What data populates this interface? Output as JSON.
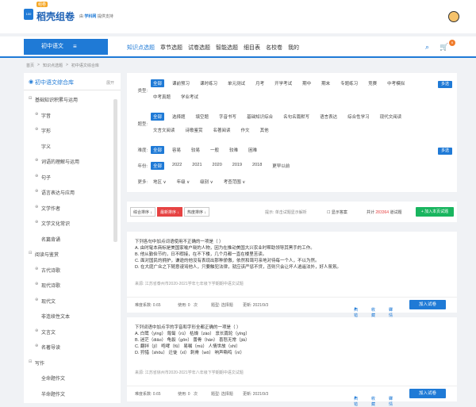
{
  "header": {
    "badge": "组卷",
    "brand": "稻壳组卷",
    "provider_prefix": "由",
    "provider_name": "学科网",
    "provider_suffix": "提供支持"
  },
  "nav": {
    "subject": "初中语文",
    "items": [
      "知识点选题",
      "章节选题",
      "试卷选题",
      "智能选题",
      "细目表",
      "名校卷",
      "我的"
    ],
    "cart_count": "6"
  },
  "breadcrumb": [
    "首页",
    ">",
    "知识点选题",
    ">",
    "初中语文综合库"
  ],
  "sidebar": {
    "title": "初中语文综合库",
    "expand": "展开",
    "tree": [
      {
        "toggle": "⊟",
        "label": "基础知识积累与运用",
        "level": 0
      },
      {
        "toggle": "⊕",
        "label": "字音",
        "level": 1
      },
      {
        "toggle": "⊕",
        "label": "字形",
        "level": 1
      },
      {
        "toggle": "",
        "label": "字义",
        "level": 1
      },
      {
        "toggle": "⊕",
        "label": "词语的理解与运用",
        "level": 1
      },
      {
        "toggle": "⊕",
        "label": "句子",
        "level": 1
      },
      {
        "toggle": "⊕",
        "label": "语言表达与应用",
        "level": 1
      },
      {
        "toggle": "⊕",
        "label": "文学作者",
        "level": 1
      },
      {
        "toggle": "⊕",
        "label": "文学文化常识",
        "level": 1
      },
      {
        "toggle": "",
        "label": "名篇背诵",
        "level": 1
      },
      {
        "toggle": "⊟",
        "label": "阅读与鉴赏",
        "level": 0
      },
      {
        "toggle": "⊕",
        "label": "古代诗歌",
        "level": 1
      },
      {
        "toggle": "⊕",
        "label": "现代诗歌",
        "level": 1
      },
      {
        "toggle": "⊕",
        "label": "现代文",
        "level": 1
      },
      {
        "toggle": "",
        "label": "非连续性文本",
        "level": 1
      },
      {
        "toggle": "⊕",
        "label": "文言文",
        "level": 1
      },
      {
        "toggle": "⊕",
        "label": "名著导读",
        "level": 1
      },
      {
        "toggle": "⊟",
        "label": "写作",
        "level": 0
      },
      {
        "toggle": "",
        "label": "全命题作文",
        "level": 1
      },
      {
        "toggle": "",
        "label": "半命题作文",
        "level": 1
      }
    ]
  },
  "filters": {
    "type": {
      "label": "类型:",
      "options": [
        "全部",
        "课前预习",
        "课时练习",
        "单元测试",
        "月考",
        "开学考试",
        "期中",
        "期末",
        "专题练习",
        "竞赛",
        "中考模拟",
        "中考真题",
        "学业考试"
      ],
      "more": "多选"
    },
    "qtype": {
      "label": "题型:",
      "options": [
        "全部",
        "选择题",
        "填空题",
        "字音书写",
        "基础知识综合",
        "名句名篇默写",
        "语言表达",
        "综合性学习",
        "现代文阅读",
        "文言文阅读",
        "诗歌鉴赏",
        "名著阅读",
        "作文",
        "其他"
      ]
    },
    "difficulty": {
      "label": "难度:",
      "options": [
        "全部",
        "容易",
        "较易",
        "一般",
        "较难",
        "困难"
      ],
      "more": "多选"
    },
    "year": {
      "label": "年份:",
      "options": [
        "全部",
        "2022",
        "2021",
        "2020",
        "2019",
        "2018",
        "更早以前"
      ]
    },
    "more": {
      "label": "更多:",
      "options": [
        "地区 ∨",
        "年级 ∨",
        "级别 ∨",
        "考查范围 ∨"
      ]
    }
  },
  "sortbar": {
    "buttons": [
      "综合排序 ↓",
      "最新排序 ↓",
      "热度排序 ↓"
    ],
    "hint": "提示: 单击试题显示解析",
    "checkbox": "☐ 显示答案",
    "total_prefix": "共计",
    "total_count": "283364",
    "total_suffix": "道试题",
    "add_all": "+ 加入本页试题"
  },
  "questions": [
    {
      "lines": [
        "下列各句中加点词语使用不正确的一项是（  ）",
        "A. 由时髦本商标是美国家喻户晓的人物，因为在推动美国大兴农业时帮助领导其黑手的工作。",
        "B. 他从勤俭节约，日不暇接，在不下楼，几个月都一直在楼里苦读。",
        "C. 面对国民的拥护，谦逊的他没有表现出那种骄傲，依然和蔼可亲地对待每一个人，不以为然。",
        "D. 在大庭广众之下随意谩骂他人，只要触犯法律，就应该严惩不贷，否则只会让坏人逍遥法外，好人氛氛。"
      ],
      "source": "来源: 江苏省泰州市2020-2021学年七年级下学期期中语文试题",
      "difficulty": "难度系数: 0.65",
      "used": "使用: 0",
      "used_unit": "次",
      "type": "题型: 选择题",
      "date": "更新: 2021/9/3",
      "actions": [
        "纠错",
        "收藏",
        "详情"
      ],
      "add": "加入试卷"
    },
    {
      "lines": [
        "下列词语中加点字的字音和字形全都正确的一项是（  ）",
        "A. 白鹭（yìng）    匍匐（rú）    枯燥（zào）    禀长篇轮（yīng）",
        "B. 迷茫（diāo）    龟裂（gōn）    蕾骨（hán）    喜怒无常（jià）",
        "C. 翻拌（jī）      咆哮（fǔ）    易嘱（mù）    人情世故（shì）",
        "D. 狩猎（shōu）    迁徙（xǐ）    刺骨（wò）    响声嘶鸣（nì）"
      ],
      "source": "来源: 江苏省徐州市2020-2021学年八年级下学期期中语文试题",
      "difficulty": "难度系数: 0.65",
      "used": "使用: 0",
      "used_unit": "次",
      "type": "题型: 选择题",
      "date": "更新: 2021/9/3",
      "actions": [
        "纠错",
        "收藏",
        "详情"
      ],
      "add": "加入试卷"
    }
  ]
}
